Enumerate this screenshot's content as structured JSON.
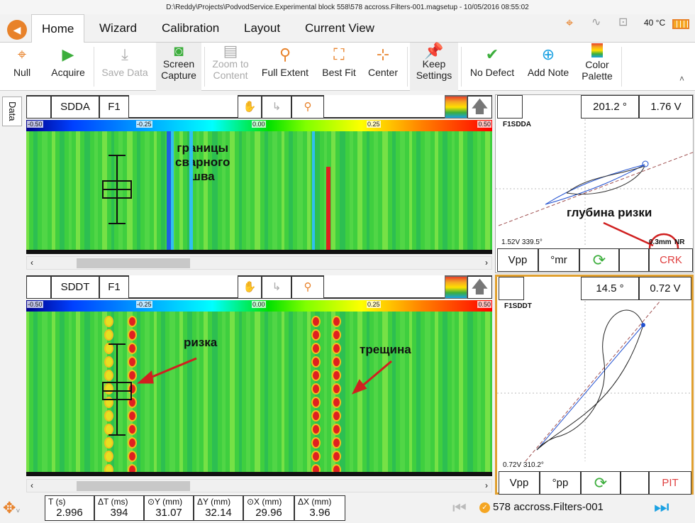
{
  "window": {
    "title": "D:\\Reddy\\Projects\\PodvodService.Experimental block 558\\578 accross.Filters-001.magsetup - 10/05/2016 08:55:02"
  },
  "tabs": [
    {
      "label": "Home",
      "active": true
    },
    {
      "label": "Wizard"
    },
    {
      "label": "Calibration"
    },
    {
      "label": "Layout"
    },
    {
      "label": "Current View"
    }
  ],
  "status": {
    "temperature": "40 °C",
    "icons": [
      "probe-icon",
      "signal-icon",
      "connection-icon",
      "battery-icon"
    ]
  },
  "ribbon": [
    {
      "label": "Null",
      "icon": "crosshair-icon"
    },
    {
      "label": "Acquire",
      "icon": "play-icon"
    },
    {
      "label": "Save Data",
      "icon": "download-icon",
      "disabled": true
    },
    {
      "label": "Screen Capture",
      "icon": "camera-icon"
    },
    {
      "label": "Zoom to Content",
      "icon": "zoom-document-icon",
      "disabled": true
    },
    {
      "label": "Full Extent",
      "icon": "magnifier-icon"
    },
    {
      "label": "Best Fit",
      "icon": "best-fit-icon"
    },
    {
      "label": "Center",
      "icon": "center-icon"
    },
    {
      "label": "Keep Settings",
      "icon": "pin-icon"
    },
    {
      "label": "No Defect",
      "icon": "shield-check-icon"
    },
    {
      "label": "Add Note",
      "icon": "note-add-icon"
    },
    {
      "label": "Color Palette",
      "icon": "palette-icon"
    }
  ],
  "side_tab": "Data",
  "strips": [
    {
      "channel": "SDDA",
      "freq": "F1",
      "scale": [
        "-0.50",
        "-0.25",
        "0.00",
        "0.25",
        "0.50"
      ],
      "annotations": [
        "границы\nсварного\nшва"
      ]
    },
    {
      "channel": "SDDT",
      "freq": "F1",
      "scale": [
        "-0.50",
        "-0.25",
        "0.00",
        "0.25",
        "0.50"
      ],
      "annotations": [
        "ризка",
        "трещина"
      ]
    }
  ],
  "lissajous": [
    {
      "phase": "201.2 °",
      "amplitude": "1.76 V",
      "name": "F1SDDA",
      "readout": "1.52V 339.5°",
      "depth": "0.3mm",
      "nr": "NR",
      "annotation": "глубина ризки",
      "mode1": "Vpp",
      "mode2": "°mr",
      "result": "CRK"
    },
    {
      "phase": "14.5 °",
      "amplitude": "0.72 V",
      "name": "F1SDDT",
      "readout": "0.72V 310.2°",
      "mode1": "Vpp",
      "mode2": "°pp",
      "result": "PIT"
    }
  ],
  "measurements": [
    {
      "label": "T (s)",
      "value": "2.996"
    },
    {
      "label": "ΔT (ms)",
      "value": "394"
    },
    {
      "label": "⊙Y (mm)",
      "value": "31.07"
    },
    {
      "label": "ΔY (mm)",
      "value": "32.14"
    },
    {
      "label": "⊙X (mm)",
      "value": "29.96"
    },
    {
      "label": "ΔX (mm)",
      "value": "3.96"
    }
  ],
  "file": {
    "name": "578 accross.Filters-001"
  },
  "colors": {
    "accent": "#e8822a",
    "green": "#3cae3c",
    "blue": "#1ba1e2",
    "result_red": "#e04040"
  }
}
